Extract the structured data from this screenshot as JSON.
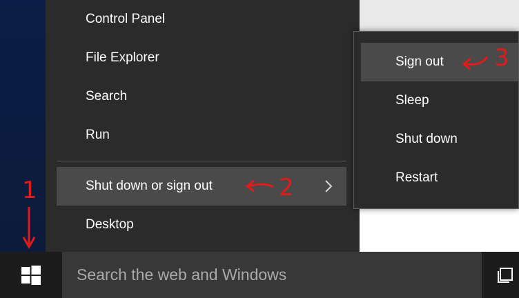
{
  "winx_menu": {
    "items": [
      {
        "label": "Control Panel"
      },
      {
        "label": "File Explorer"
      },
      {
        "label": "Search"
      },
      {
        "label": "Run"
      },
      {
        "label": "Shut down or sign out"
      },
      {
        "label": "Desktop"
      }
    ]
  },
  "flyout": {
    "items": [
      {
        "label": "Sign out"
      },
      {
        "label": "Sleep"
      },
      {
        "label": "Shut down"
      },
      {
        "label": "Restart"
      }
    ]
  },
  "taskbar": {
    "search_placeholder": "Search the web and Windows"
  },
  "annotations": {
    "step1": "1",
    "step2": "2",
    "step3": "3"
  },
  "colors": {
    "menu_bg": "#2b2b2b",
    "highlight": "#4a4a4a",
    "annotation": "#e11b1b"
  },
  "icons": {
    "start": "windows-logo-icon",
    "submenu": "chevron-right-icon",
    "task_view": "task-view-icon"
  }
}
